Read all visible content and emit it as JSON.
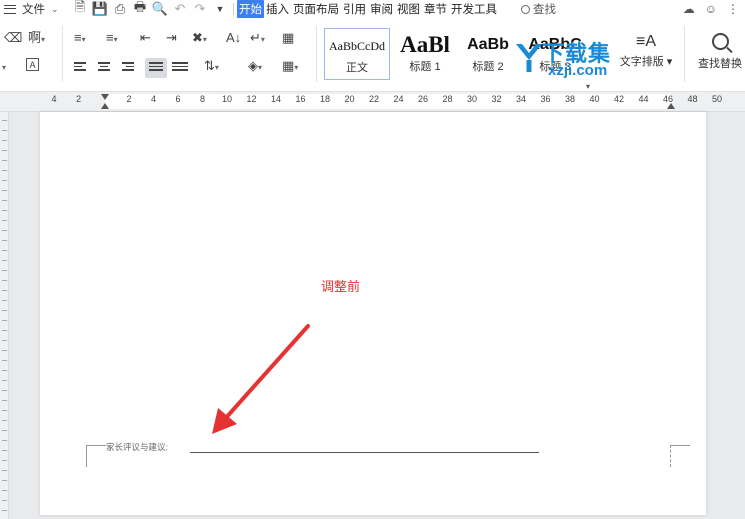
{
  "menubar": {
    "file_label": "文件",
    "tabs": [
      "开始",
      "插入",
      "页面布局",
      "引用",
      "审阅",
      "视图",
      "章节",
      "开发工具"
    ],
    "active_tab": "开始",
    "search_label": "查找"
  },
  "ribbon": {
    "styles": [
      {
        "sample": "AaBbCcDd",
        "name": "正文"
      },
      {
        "sample": "AaBl",
        "name": "标题 1"
      },
      {
        "sample": "AaBb",
        "name": "标题 2"
      },
      {
        "sample": "AaBbC",
        "name": "标题 3"
      }
    ],
    "text_layout_label": "文字排版",
    "find_replace_label": "查找替换"
  },
  "watermark": {
    "title": "下载集",
    "url": "xzji.com"
  },
  "ruler": {
    "ticks": [
      "4",
      "2",
      "2",
      "4",
      "6",
      "8",
      "10",
      "12",
      "14",
      "16",
      "18",
      "20",
      "22",
      "24",
      "26",
      "28",
      "30",
      "32",
      "34",
      "36",
      "38",
      "40",
      "42",
      "44",
      "46",
      "48",
      "50"
    ]
  },
  "document": {
    "annotation": "调整前",
    "field_label": "家长评议与建议:"
  },
  "colors": {
    "annotation": "#e63232",
    "active_tab": "#3c7ef6",
    "watermark": "#1a8ad6"
  }
}
